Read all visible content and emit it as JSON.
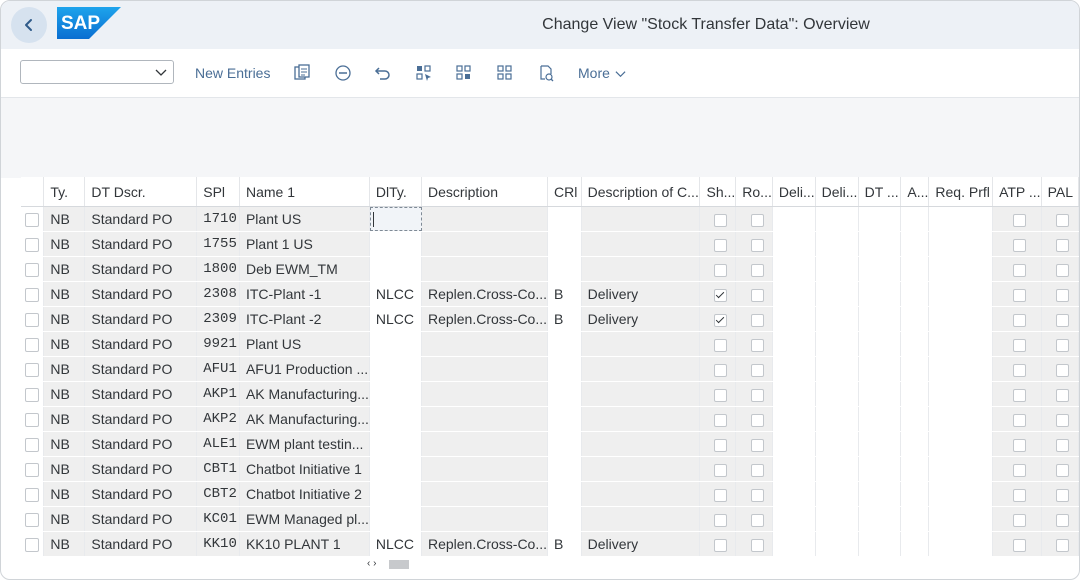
{
  "header": {
    "logo_text": "SAP",
    "title": "Change View \"Stock Transfer Data\": Overview"
  },
  "toolbar": {
    "select_value": "",
    "new_entries_label": "New Entries",
    "more_label": "More"
  },
  "table": {
    "columns": [
      "Ty.",
      "DT Dscr.",
      "SPl",
      "Name 1",
      "DlTy.",
      "Description",
      "CRl",
      "Description of C...",
      "Sh...",
      "Ro...",
      "Deli...",
      "Deli...",
      "DT ...",
      "A...",
      "Req. Prfl",
      "ATP ...",
      "PAL"
    ],
    "rows": [
      {
        "ty": "NB",
        "dt": "Standard PO",
        "spl": "1710",
        "name": "Plant US",
        "dlty": "",
        "desc": "",
        "crl": "",
        "descc": "",
        "sh": false
      },
      {
        "ty": "NB",
        "dt": "Standard PO",
        "spl": "1755",
        "name": "Plant 1 US",
        "dlty": "",
        "desc": "",
        "crl": "",
        "descc": "",
        "sh": false
      },
      {
        "ty": "NB",
        "dt": "Standard PO",
        "spl": "1800",
        "name": "Deb EWM_TM",
        "dlty": "",
        "desc": "",
        "crl": "",
        "descc": "",
        "sh": false
      },
      {
        "ty": "NB",
        "dt": "Standard PO",
        "spl": "2308",
        "name": "ITC-Plant -1",
        "dlty": "NLCC",
        "desc": "Replen.Cross-Co...",
        "crl": "B",
        "descc": "Delivery",
        "sh": true
      },
      {
        "ty": "NB",
        "dt": "Standard PO",
        "spl": "2309",
        "name": "ITC-Plant -2",
        "dlty": "NLCC",
        "desc": "Replen.Cross-Co...",
        "crl": "B",
        "descc": "Delivery",
        "sh": true
      },
      {
        "ty": "NB",
        "dt": "Standard PO",
        "spl": "9921",
        "name": "Plant US",
        "dlty": "",
        "desc": "",
        "crl": "",
        "descc": "",
        "sh": false
      },
      {
        "ty": "NB",
        "dt": "Standard PO",
        "spl": "AFU1",
        "name": "AFU1 Production ...",
        "dlty": "",
        "desc": "",
        "crl": "",
        "descc": "",
        "sh": false
      },
      {
        "ty": "NB",
        "dt": "Standard PO",
        "spl": "AKP1",
        "name": "AK Manufacturing...",
        "dlty": "",
        "desc": "",
        "crl": "",
        "descc": "",
        "sh": false
      },
      {
        "ty": "NB",
        "dt": "Standard PO",
        "spl": "AKP2",
        "name": "AK Manufacturing...",
        "dlty": "",
        "desc": "",
        "crl": "",
        "descc": "",
        "sh": false
      },
      {
        "ty": "NB",
        "dt": "Standard PO",
        "spl": "ALE1",
        "name": "EWM plant testin...",
        "dlty": "",
        "desc": "",
        "crl": "",
        "descc": "",
        "sh": false
      },
      {
        "ty": "NB",
        "dt": "Standard PO",
        "spl": "CBT1",
        "name": "Chatbot Initiative 1",
        "dlty": "",
        "desc": "",
        "crl": "",
        "descc": "",
        "sh": false
      },
      {
        "ty": "NB",
        "dt": "Standard PO",
        "spl": "CBT2",
        "name": "Chatbot Initiative 2",
        "dlty": "",
        "desc": "",
        "crl": "",
        "descc": "",
        "sh": false
      },
      {
        "ty": "NB",
        "dt": "Standard PO",
        "spl": "KC01",
        "name": "EWM Managed pl...",
        "dlty": "",
        "desc": "",
        "crl": "",
        "descc": "",
        "sh": false
      },
      {
        "ty": "NB",
        "dt": "Standard PO",
        "spl": "KK10",
        "name": "KK10 PLANT 1",
        "dlty": "NLCC",
        "desc": "Replen.Cross-Co...",
        "crl": "B",
        "descc": "Delivery",
        "sh": false
      }
    ]
  },
  "colors": {
    "shell": "#edf1f6",
    "link": "#4a6e96",
    "readonly_cell": "#efefef"
  }
}
